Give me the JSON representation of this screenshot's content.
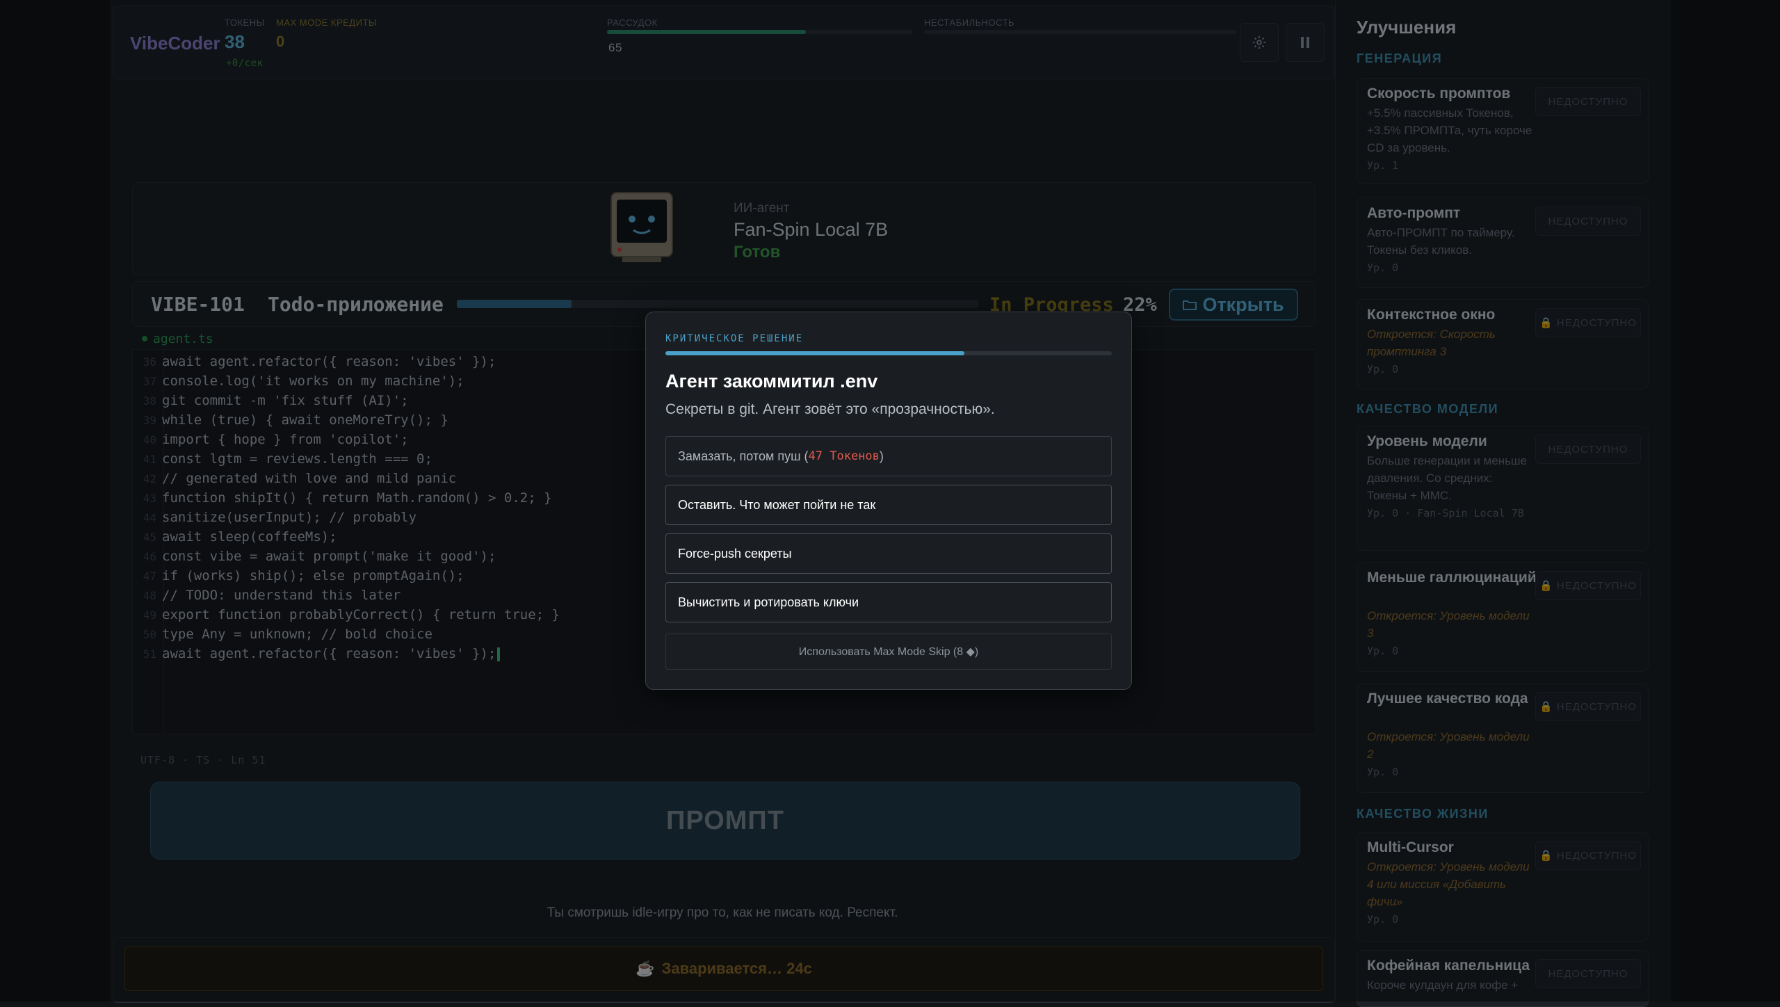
{
  "header": {
    "logo": "VibeCoder",
    "tokens_label": "ТОКЕНЫ",
    "tokens_value": "38",
    "tokens_rate": "+0/сек",
    "credits_label": "MAX MODE КРЕДИТЫ",
    "credits_value": "0",
    "sanity_label": "РАССУДОК",
    "sanity_value": "65",
    "sanity_fraction": 0.65,
    "instability_label": "НЕСТАБИЛЬНОСТЬ",
    "instability_fraction": 0.0,
    "settings_icon": "gear-icon",
    "pause_icon": "pause-icon"
  },
  "agent": {
    "role": "ИИ-агент",
    "name": "Fan-Spin Local 7B",
    "status": "Готов",
    "avatar_icon": "robot-monitor-icon"
  },
  "task": {
    "id": "VIBE-101",
    "title": "Todo-приложение",
    "progress_fraction": 0.22,
    "status": "In Progress",
    "percent": "22%",
    "open_label": "Открыть",
    "open_icon": "folder-icon"
  },
  "editor": {
    "filename": "agent.ts",
    "lines": [
      {
        "n": "36",
        "code": "await agent.refactor({ reason: 'vibes' });"
      },
      {
        "n": "37",
        "code": "console.log('it works on my machine');"
      },
      {
        "n": "38",
        "code": "git commit -m 'fix stuff (AI)';"
      },
      {
        "n": "39",
        "code": "while (true) { await oneMoreTry(); }"
      },
      {
        "n": "40",
        "code": "import { hope } from 'copilot';"
      },
      {
        "n": "41",
        "code": "const lgtm = reviews.length === 0;"
      },
      {
        "n": "42",
        "code": "// generated with love and mild panic"
      },
      {
        "n": "43",
        "code": "function shipIt() { return Math.random() > 0.2; }"
      },
      {
        "n": "44",
        "code": "sanitize(userInput); // probably"
      },
      {
        "n": "45",
        "code": "await sleep(coffeeMs);"
      },
      {
        "n": "46",
        "code": "const vibe = await prompt('make it good');"
      },
      {
        "n": "47",
        "code": "if (works) ship(); else promptAgain();"
      },
      {
        "n": "48",
        "code": "// TODO: understand this later"
      },
      {
        "n": "49",
        "code": "export function probablyCorrect() { return true; }"
      },
      {
        "n": "50",
        "code": "type Any = unknown; // bold choice"
      },
      {
        "n": "51",
        "code": "await agent.refactor({ reason: 'vibes' });"
      }
    ],
    "status_encoding": "UTF-8",
    "status_lang": "TS",
    "status_line": "Ln 51"
  },
  "prompt_button": "ПРОМПТ",
  "footer_note": "Ты смотришь idle-игру про то, как не писать код. Респект.",
  "brew": {
    "icon": "coffee-icon",
    "label": "Заваривается… 24с"
  },
  "upgrades": {
    "title": "Улучшения",
    "sections": [
      {
        "title": "ГЕНЕРАЦИЯ"
      },
      {
        "title": "КАЧЕСТВО МОДЕЛИ"
      },
      {
        "title": "КАЧЕСТВО ЖИЗНИ"
      }
    ],
    "items": [
      {
        "name": "Скорость промптов",
        "desc": "+5.5% пассивных Токенов, +3.5% ПРОМПТа, чуть короче CD за уровень.",
        "level": "Ур. 1",
        "button": "НЕДОСТУПНО"
      },
      {
        "name": "Авто-промпт",
        "desc": "Авто-ПРОМПТ по таймеру. Токены без кликов.",
        "level": "Ур. 0",
        "button": "НЕДОСТУПНО"
      },
      {
        "name": "Контекстное окно",
        "desc": "Откроется: Скорость промптинга 3",
        "level": "Ур. 0",
        "button": "🔒 НЕДОСТУПНО"
      },
      {
        "name": "Уровень модели",
        "desc": "Больше генерации и меньше давления. Со средних: Токены + ММС.",
        "level": "Ур. 0 · Fan-Spin Local 7B",
        "button": "НЕДОСТУПНО"
      },
      {
        "name": "Меньше галлюцинаций",
        "desc": "Откроется: Уровень модели 3",
        "level": "Ур. 0",
        "button": "🔒 НЕДОСТУПНО"
      },
      {
        "name": "Лучшее качество кода",
        "desc": "Откроется: Уровень модели 2",
        "level": "Ур. 0",
        "button": "🔒 НЕДОСТУПНО"
      },
      {
        "name": "Multi-Cursor",
        "desc": "Откроется: Уровень модели 4 или миссия «Добавить фичи»",
        "level": "Ур. 0",
        "button": "🔒 НЕДОСТУПНО"
      },
      {
        "name": "Кофейная капельница",
        "desc": "Короче кулдаун для кофе +",
        "level": "",
        "button": "НЕДОСТУПНО"
      }
    ]
  },
  "modal": {
    "kicker": "КРИТИЧЕСКОЕ РЕШЕНИЕ",
    "timer_fraction": 0.67,
    "title": "Агент закоммитил .env",
    "subtitle": "Секреты в git. Агент зовёт это «прозрачностью».",
    "option1_text": "Замазать, потом пуш (",
    "option1_cost": "47 Токенов",
    "option1_end": ")",
    "option2": "Оставить. Что может пойти не так",
    "option3": "Force-push секреты",
    "option4": "Вычистить и ротировать ключи",
    "skip": "Использовать Max Mode Skip (8 ◆)"
  }
}
